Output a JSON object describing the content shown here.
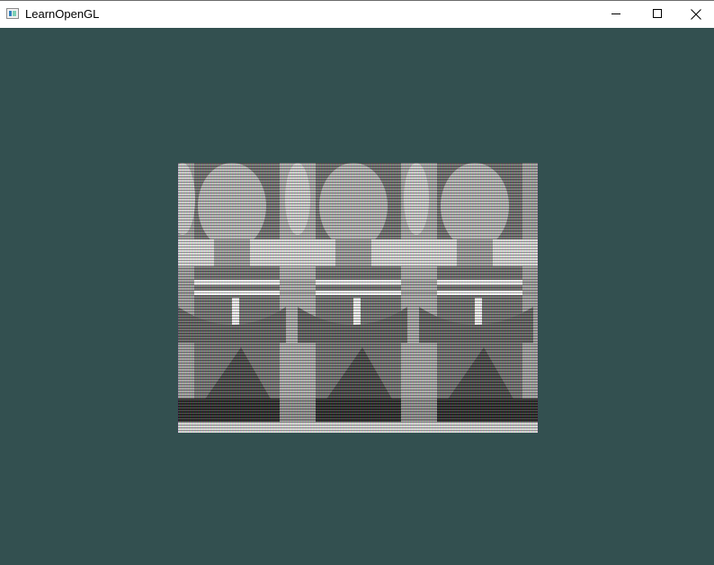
{
  "window": {
    "title": "LearnOpenGL",
    "icon": "opengl-app-icon",
    "clear_color": "#335050"
  },
  "caption_buttons": {
    "minimize_icon": "minimize-icon",
    "maximize_icon": "maximize-icon",
    "close_icon": "close-icon"
  },
  "render": {
    "description_icon": "garbled-texture-quad",
    "texture_tiles_horizontal": 3
  }
}
